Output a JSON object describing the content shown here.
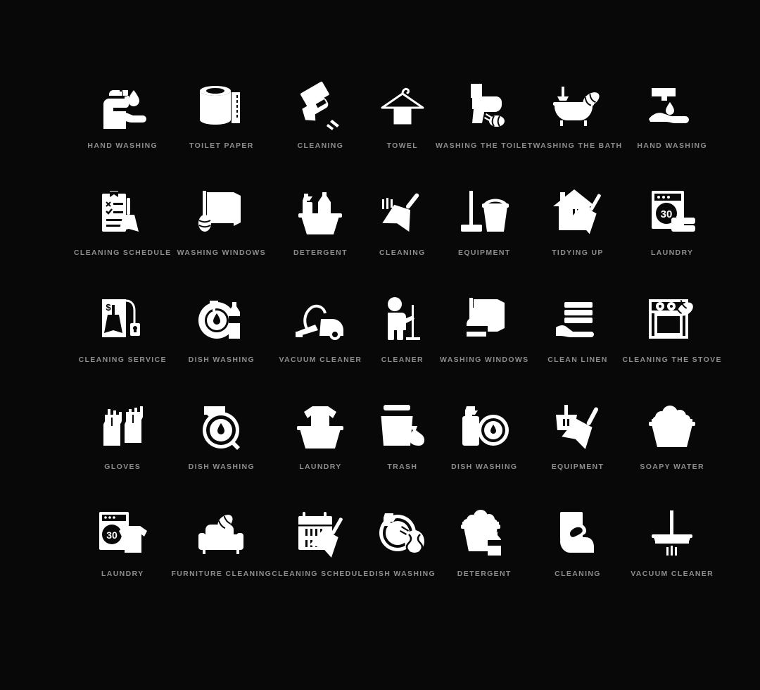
{
  "page": {
    "background_color": "#080808",
    "icon_color": "#ffffff",
    "label_color": "#8d8d8d",
    "grid_columns": 7,
    "grid_rows": 5,
    "total_icons": 35
  },
  "icons": [
    {
      "label": "HAND WASHING",
      "icon": "soap-dispenser-hand-icon"
    },
    {
      "label": "TOILET PAPER",
      "icon": "toilet-paper-roll-icon"
    },
    {
      "label": "CLEANING",
      "icon": "hand-with-cloth-icon"
    },
    {
      "label": "TOWEL",
      "icon": "towel-on-hanger-icon"
    },
    {
      "label": "WASHING THE TOILET",
      "icon": "toilet-with-sponge-icon"
    },
    {
      "label": "WASHING THE BATH",
      "icon": "bathtub-with-sponge-icon"
    },
    {
      "label": "HAND WASHING",
      "icon": "faucet-hand-water-icon"
    },
    {
      "label": "CLEANING SCHEDULE",
      "icon": "clipboard-checklist-broom-icon"
    },
    {
      "label": "WASHING WINDOWS",
      "icon": "window-with-sponge-icon"
    },
    {
      "label": "DETERGENT",
      "icon": "basin-with-bottles-icon"
    },
    {
      "label": "CLEANING",
      "icon": "broom-sweeping-icon"
    },
    {
      "label": "EQUIPMENT",
      "icon": "mop-and-bucket-icon"
    },
    {
      "label": "TIDYING UP",
      "icon": "house-with-broom-icon"
    },
    {
      "label": "LAUNDRY",
      "icon": "washing-machine-linen-icon"
    },
    {
      "label": "CLEANING SERVICE",
      "icon": "price-tag-broom-icon"
    },
    {
      "label": "DISH WASHING",
      "icon": "plate-and-bottle-icon"
    },
    {
      "label": "VACUUM CLEANER",
      "icon": "vacuum-cleaner-icon"
    },
    {
      "label": "CLEANER",
      "icon": "person-with-mop-icon"
    },
    {
      "label": "WASHING WINDOWS",
      "icon": "window-with-spray-icon"
    },
    {
      "label": "CLEAN LINEN",
      "icon": "hand-holding-linen-icon"
    },
    {
      "label": "CLEANING THE STOVE",
      "icon": "stove-with-sponge-icon"
    },
    {
      "label": "GLOVES",
      "icon": "rubber-gloves-icon"
    },
    {
      "label": "DISH WASHING",
      "icon": "plate-with-drop-icon"
    },
    {
      "label": "LAUNDRY",
      "icon": "tshirt-in-basin-icon"
    },
    {
      "label": "TRASH",
      "icon": "trash-can-with-bag-icon"
    },
    {
      "label": "DISH WASHING",
      "icon": "dish-soap-and-plate-icon"
    },
    {
      "label": "EQUIPMENT",
      "icon": "dustpan-and-brush-icon"
    },
    {
      "label": "SOAPY WATER",
      "icon": "basin-with-foam-icon"
    },
    {
      "label": "LAUNDRY",
      "icon": "washing-machine-tshirt-icon"
    },
    {
      "label": "FURNITURE CLEANING",
      "icon": "armchair-with-sponge-icon"
    },
    {
      "label": "CLEANING SCHEDULE",
      "icon": "calendar-with-broom-icon"
    },
    {
      "label": "DISH WASHING",
      "icon": "plate-and-sponge-icon"
    },
    {
      "label": "DETERGENT",
      "icon": "foam-bucket-bottle-icon"
    },
    {
      "label": "CLEANING",
      "icon": "hand-wiping-cloth-icon"
    },
    {
      "label": "VACUUM CLEANER",
      "icon": "floor-squeegee-icon"
    }
  ],
  "washing_machine_program": "30"
}
